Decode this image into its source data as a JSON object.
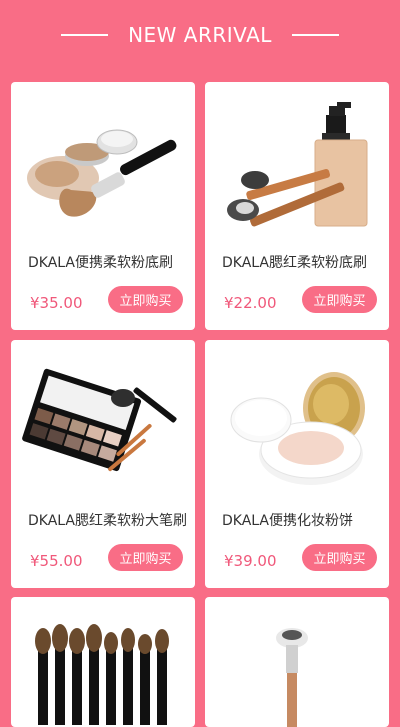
{
  "header": {
    "title": "NEW ARRIVAL"
  },
  "products": [
    {
      "name": "DKALA便携柔软粉底刷",
      "price": "¥35.00",
      "buy_label": "立即购买",
      "image": "powder-brush-icon"
    },
    {
      "name": "DKALA腮红柔软粉底刷",
      "price": "¥22.00",
      "buy_label": "立即购买",
      "image": "foundation-bottle-icon"
    },
    {
      "name": "DKALA腮红柔软粉大笔刷",
      "price": "¥55.00",
      "buy_label": "立即购买",
      "image": "eyeshadow-palette-icon"
    },
    {
      "name": "DKALA便携化妆粉饼",
      "price": "¥39.00",
      "buy_label": "立即购买",
      "image": "compact-powder-icon"
    },
    {
      "name": "",
      "price": "",
      "buy_label": "",
      "image": "brush-set-icon"
    },
    {
      "name": "",
      "price": "",
      "buy_label": "",
      "image": "single-brush-icon"
    }
  ],
  "colors": {
    "background": "#f96d86",
    "price": "#f0587a",
    "card": "#ffffff"
  }
}
